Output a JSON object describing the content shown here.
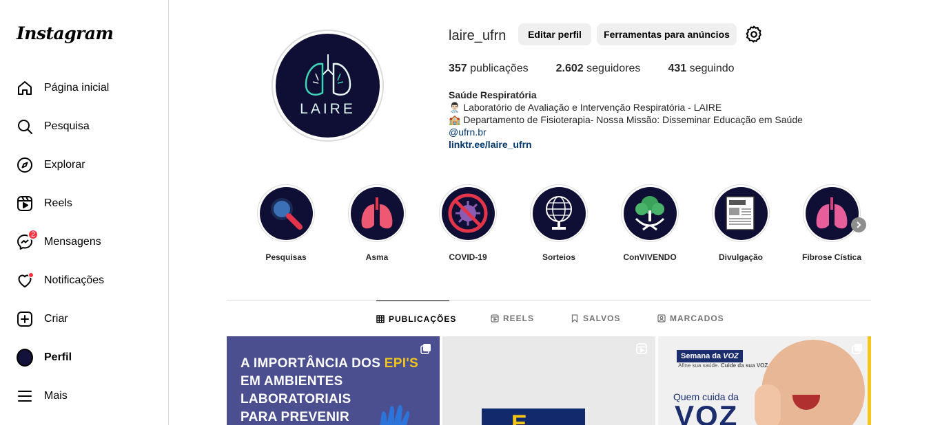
{
  "sidebar": {
    "logo": "Instagram",
    "items": [
      {
        "label": "Página inicial",
        "icon": "home-icon"
      },
      {
        "label": "Pesquisa",
        "icon": "search-icon"
      },
      {
        "label": "Explorar",
        "icon": "compass-icon"
      },
      {
        "label": "Reels",
        "icon": "reels-icon"
      },
      {
        "label": "Mensagens",
        "icon": "messenger-icon",
        "badge": "2"
      },
      {
        "label": "Notificações",
        "icon": "heart-icon"
      },
      {
        "label": "Criar",
        "icon": "plus-square-icon"
      },
      {
        "label": "Perfil",
        "icon": "profile-avatar"
      },
      {
        "label": "Mais",
        "icon": "menu-icon"
      }
    ]
  },
  "profile": {
    "username": "laire_ufrn",
    "avatar_text": "LAIRE",
    "edit_button": "Editar perfil",
    "tools_button": "Ferramentas para anúncios",
    "stats": {
      "posts_count": "357",
      "posts_label": "publicações",
      "followers_count": "2.602",
      "followers_label": "seguidores",
      "following_count": "431",
      "following_label": "seguindo"
    },
    "bio": {
      "name": "Saúde Respiratória",
      "line1": "👨🏻‍⚕️ Laboratório de Avaliação e Intervenção Respiratória - LAIRE",
      "line2": "🏫 Departamento de Fisioterapia- Nossa Missão: Disseminar Educação em Saúde",
      "mention": "@ufrn.br",
      "link": "linktr.ee/laire_ufrn"
    }
  },
  "highlights": [
    {
      "label": "Pesquisas"
    },
    {
      "label": "Asma"
    },
    {
      "label": "COVID-19"
    },
    {
      "label": "Sorteios"
    },
    {
      "label": "ConVIVENDO"
    },
    {
      "label": "Divulgação"
    },
    {
      "label": "Fibrose Cística"
    }
  ],
  "tabs": [
    {
      "label": "PUBLICAÇÕES",
      "icon": "grid-icon"
    },
    {
      "label": "REELS",
      "icon": "reels-icon"
    },
    {
      "label": "SALVOS",
      "icon": "bookmark-icon"
    },
    {
      "label": "MARCADOS",
      "icon": "tagged-icon"
    }
  ],
  "posts": {
    "p1": {
      "line1_prefix": "A IMPORTÂNCIA DOS ",
      "line1_highlight": "EPI'S",
      "line2": "EM AMBIENTES",
      "line3": "LABORATORIAIS",
      "line4": "PARA PREVENIR"
    },
    "p2": {
      "text": "E"
    },
    "p3": {
      "tag_prefix": "Semana da ",
      "tag_highlight": "VOZ",
      "sub_prefix": "Afine sua saúde. ",
      "sub_highlight": "Cuide da sua VOZ",
      "line1": "Quem cuida da",
      "line2": "VOZ"
    }
  },
  "colors": {
    "accent_red": "#ff3040",
    "link_blue": "#00376b",
    "brand_navy": "#0f0f35",
    "post_yellow": "#f5c518"
  }
}
